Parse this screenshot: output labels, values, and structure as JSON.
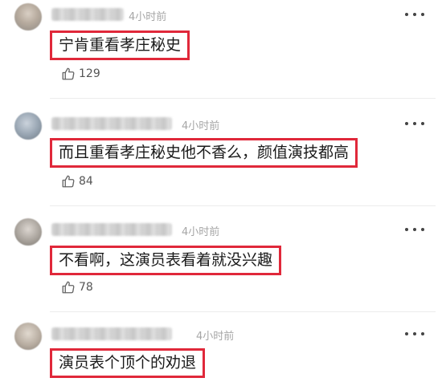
{
  "comments": [
    {
      "time": "4小时前",
      "text": "宁肯重看孝庄秘史",
      "likes": "129",
      "icons": {
        "avatar": "avatar",
        "like": "thumbs-up-icon",
        "more": "more-dots-icon"
      }
    },
    {
      "time": "4小时前",
      "text": "而且重看孝庄秘史他不香么，颜值演技都高",
      "likes": "84",
      "icons": {
        "avatar": "avatar",
        "like": "thumbs-up-icon",
        "more": "more-dots-icon"
      }
    },
    {
      "time": "4小时前",
      "text": "不看啊，这演员表看着就没兴趣",
      "likes": "78",
      "icons": {
        "avatar": "avatar",
        "like": "thumbs-up-icon",
        "more": "more-dots-icon"
      }
    },
    {
      "time": "4小时前",
      "text": "演员表个顶个的劝退",
      "icons": {
        "avatar": "avatar",
        "more": "more-dots-icon"
      }
    }
  ],
  "colors": {
    "highlight_border": "#e0283a",
    "timestamp": "#a6a6a6",
    "text": "#1a1a1a",
    "like_count": "#555555"
  }
}
